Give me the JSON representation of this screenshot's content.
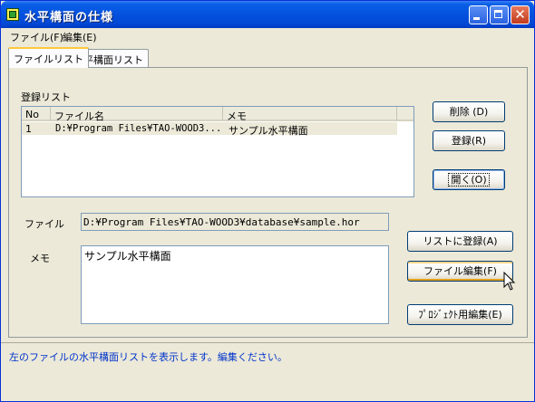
{
  "window": {
    "title": "水平構面の仕様"
  },
  "menu": [
    "ファイル(F)",
    "編集(E)"
  ],
  "tabs": [
    {
      "label": "ファイルリスト",
      "active": true
    },
    {
      "label": "水平構面リスト",
      "active": false
    }
  ],
  "registered_list": {
    "label": "登録リスト",
    "columns": [
      "No",
      "ファイル名",
      "メモ"
    ],
    "rows": [
      {
        "no": "1",
        "file": "D:¥Program Files¥TAO-WOOD3...",
        "memo": "サンプル水平構面"
      }
    ]
  },
  "buttons": {
    "delete": "削除 (D)",
    "register": "登録(R)",
    "open": "開く(O)",
    "register_to_list": "リストに登録(A)",
    "edit_file": "ファイル編集(F)",
    "edit_for_project": "ﾌﾟﾛｼﾞｪｸﾄ用編集(E)"
  },
  "file_field": {
    "label": "ファイル",
    "value": "D:¥Program Files¥TAO-WOOD3¥database¥sample.hor"
  },
  "memo_field": {
    "label": "メモ",
    "value": "サンプル水平構面"
  },
  "status": "左のファイルの水平構面リストを表示します。編集ください。",
  "colors": {
    "titlebar": "#0553e0",
    "status_text": "#0033cc",
    "tab_highlight": "#ffc83c",
    "background": "#ece9d8"
  },
  "icons": [
    "app-icon",
    "minimize-icon",
    "maximize-icon",
    "close-icon",
    "mouse-cursor-icon"
  ]
}
